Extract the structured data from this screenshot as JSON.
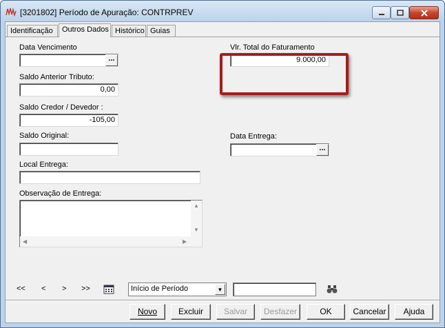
{
  "window": {
    "title": "[3201802]  Período de Apuração: CONTRPREV",
    "app_icon": "app-logo-icon",
    "controls": [
      "minimize-icon",
      "maximize-icon",
      "close-icon"
    ]
  },
  "tabs": [
    {
      "label": "Identificação"
    },
    {
      "label": "Outros Dados",
      "active": true
    },
    {
      "label": "Histórico"
    },
    {
      "label": "Guias"
    }
  ],
  "form": {
    "data_vencimento": {
      "label": "Data Vencimento",
      "value": "",
      "button": "..."
    },
    "saldo_anterior": {
      "label": "Saldo Anterior Tributo:",
      "value": "0,00"
    },
    "saldo_credor": {
      "label": "Saldo Credor / Devedor :",
      "value": "-105,00"
    },
    "saldo_original": {
      "label": "Saldo Original:",
      "value": ""
    },
    "local_entrega": {
      "label": "Local Entrega:",
      "value": ""
    },
    "observacao": {
      "label": "Observação de Entrega:",
      "value": ""
    },
    "vlr_total": {
      "label": "Vlr. Total do Faturamento",
      "value": "9.000,00"
    },
    "data_entrega": {
      "label": "Data Entrega:",
      "value": "",
      "button": "..."
    }
  },
  "navigation": {
    "first": "<<",
    "prev": "<",
    "next": ">",
    "last": ">>",
    "calendar_icon": "calendar-icon",
    "period_select": "Início de Período",
    "search_value": "",
    "search_icon": "binoculars-icon"
  },
  "buttons": {
    "novo": "Novo",
    "excluir": "Excluir",
    "salvar": "Salvar",
    "desfazer": "Desfazer",
    "ok": "OK",
    "cancelar": "Cancelar",
    "ajuda": "Ajuda"
  },
  "colors": {
    "highlight_border": "#a51c1c",
    "window_frame": "#bcd3ea",
    "close_button": "#c7452d"
  }
}
